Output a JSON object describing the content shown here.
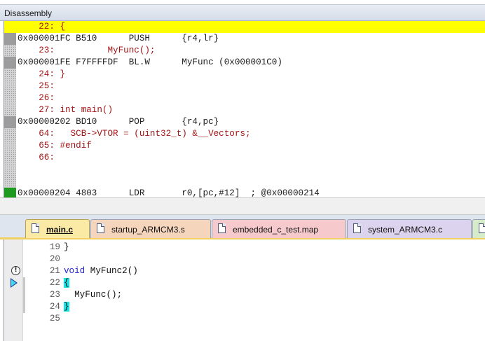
{
  "disassembly": {
    "title": "Disassembly",
    "lines": [
      {
        "kind": "src",
        "text": "    22: {",
        "highlight": true,
        "marker": ""
      },
      {
        "kind": "asm",
        "text": "0x000001FC B510      PUSH      {r4,lr}",
        "highlight": false,
        "marker": "gray"
      },
      {
        "kind": "src",
        "text": "    23:          MyFunc();",
        "highlight": false,
        "marker": ""
      },
      {
        "kind": "asm",
        "text": "0x000001FE F7FFFFDF  BL.W      MyFunc (0x000001C0)",
        "highlight": false,
        "marker": "gray"
      },
      {
        "kind": "src",
        "text": "    24: }",
        "highlight": false,
        "marker": ""
      },
      {
        "kind": "src",
        "text": "    25:",
        "highlight": false,
        "marker": ""
      },
      {
        "kind": "src",
        "text": "    26:",
        "highlight": false,
        "marker": ""
      },
      {
        "kind": "src",
        "text": "    27: int main()",
        "highlight": false,
        "marker": ""
      },
      {
        "kind": "asm",
        "text": "0x00000202 BD10      POP       {r4,pc}",
        "highlight": false,
        "marker": "gray"
      },
      {
        "kind": "src",
        "text": "    64:   SCB->VTOR = (uint32_t) &__Vectors;",
        "highlight": false,
        "marker": ""
      },
      {
        "kind": "src",
        "text": "    65: #endif",
        "highlight": false,
        "marker": ""
      },
      {
        "kind": "src",
        "text": "    66:",
        "highlight": false,
        "marker": ""
      },
      {
        "kind": "asm",
        "text": "0x00000204 4803      LDR       r0,[pc,#12]  ; @0x00000214",
        "highlight": false,
        "marker": "green"
      }
    ]
  },
  "tabs": [
    {
      "label": "main.c",
      "active": true,
      "color": "active"
    },
    {
      "label": "startup_ARMCM3.s",
      "active": false,
      "color": "peach"
    },
    {
      "label": "embedded_c_test.map",
      "active": false,
      "color": "pink"
    },
    {
      "label": "system_ARMCM3.c",
      "active": false,
      "color": "lilac"
    }
  ],
  "editor": {
    "lines": [
      {
        "num": "19",
        "code": "}",
        "marker": ""
      },
      {
        "num": "20",
        "code": "",
        "marker": ""
      },
      {
        "num": "21",
        "code": "void MyFunc2()",
        "marker": "warning-icon"
      },
      {
        "num": "22",
        "code": "{",
        "marker": "execution-arrow-icon"
      },
      {
        "num": "23",
        "code": "  MyFunc();",
        "marker": ""
      },
      {
        "num": "24",
        "code": "}",
        "marker": ""
      },
      {
        "num": "25",
        "code": "",
        "marker": ""
      }
    ]
  }
}
